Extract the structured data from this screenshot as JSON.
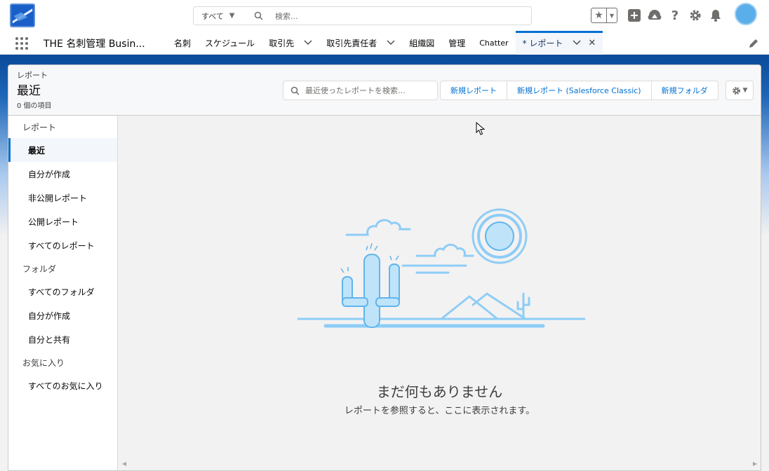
{
  "search": {
    "scope_label": "すべて",
    "placeholder": "検索..."
  },
  "app": {
    "name": "THE 名刺管理 Busin..."
  },
  "nav": {
    "items": [
      {
        "label": "名刺"
      },
      {
        "label": "スケジュール"
      },
      {
        "label": "取引先"
      },
      {
        "label": "取引先責任者"
      },
      {
        "label": "組織図"
      },
      {
        "label": "管理"
      },
      {
        "label": "Chatter"
      },
      {
        "label": "* レポート"
      }
    ]
  },
  "page": {
    "object_label": "レポート",
    "title": "最近",
    "count": "0 個の項目",
    "search_placeholder": "最近使ったレポートを検索...",
    "buttons": {
      "new_report": "新規レポート",
      "new_report_classic": "新規レポート (Salesforce Classic)",
      "new_folder": "新規フォルダ"
    }
  },
  "sidebar": {
    "section_reports": "レポート",
    "reports": [
      {
        "label": "最近"
      },
      {
        "label": "自分が作成"
      },
      {
        "label": "非公開レポート"
      },
      {
        "label": "公開レポート"
      },
      {
        "label": "すべてのレポート"
      }
    ],
    "section_folders": "フォルダ",
    "folders": [
      {
        "label": "すべてのフォルダ"
      },
      {
        "label": "自分が作成"
      },
      {
        "label": "自分と共有"
      }
    ],
    "section_favorites": "お気に入り",
    "favorites": [
      {
        "label": "すべてのお気に入り"
      }
    ]
  },
  "empty_state": {
    "title": "まだ何もありません",
    "subtitle": "レポートを参照すると、ここに表示されます。"
  },
  "colors": {
    "brand": "#0070d2",
    "header_band": "#0a4a9a",
    "illustration": "#8ecdf6"
  },
  "icons": [
    "app-logo-icon",
    "search-icon",
    "chevron-down-icon",
    "star-icon",
    "plus-icon",
    "trailhead-icon",
    "help-icon",
    "gear-icon",
    "bell-icon",
    "waffle-icon",
    "close-icon",
    "pencil-icon",
    "cursor-icon"
  ]
}
